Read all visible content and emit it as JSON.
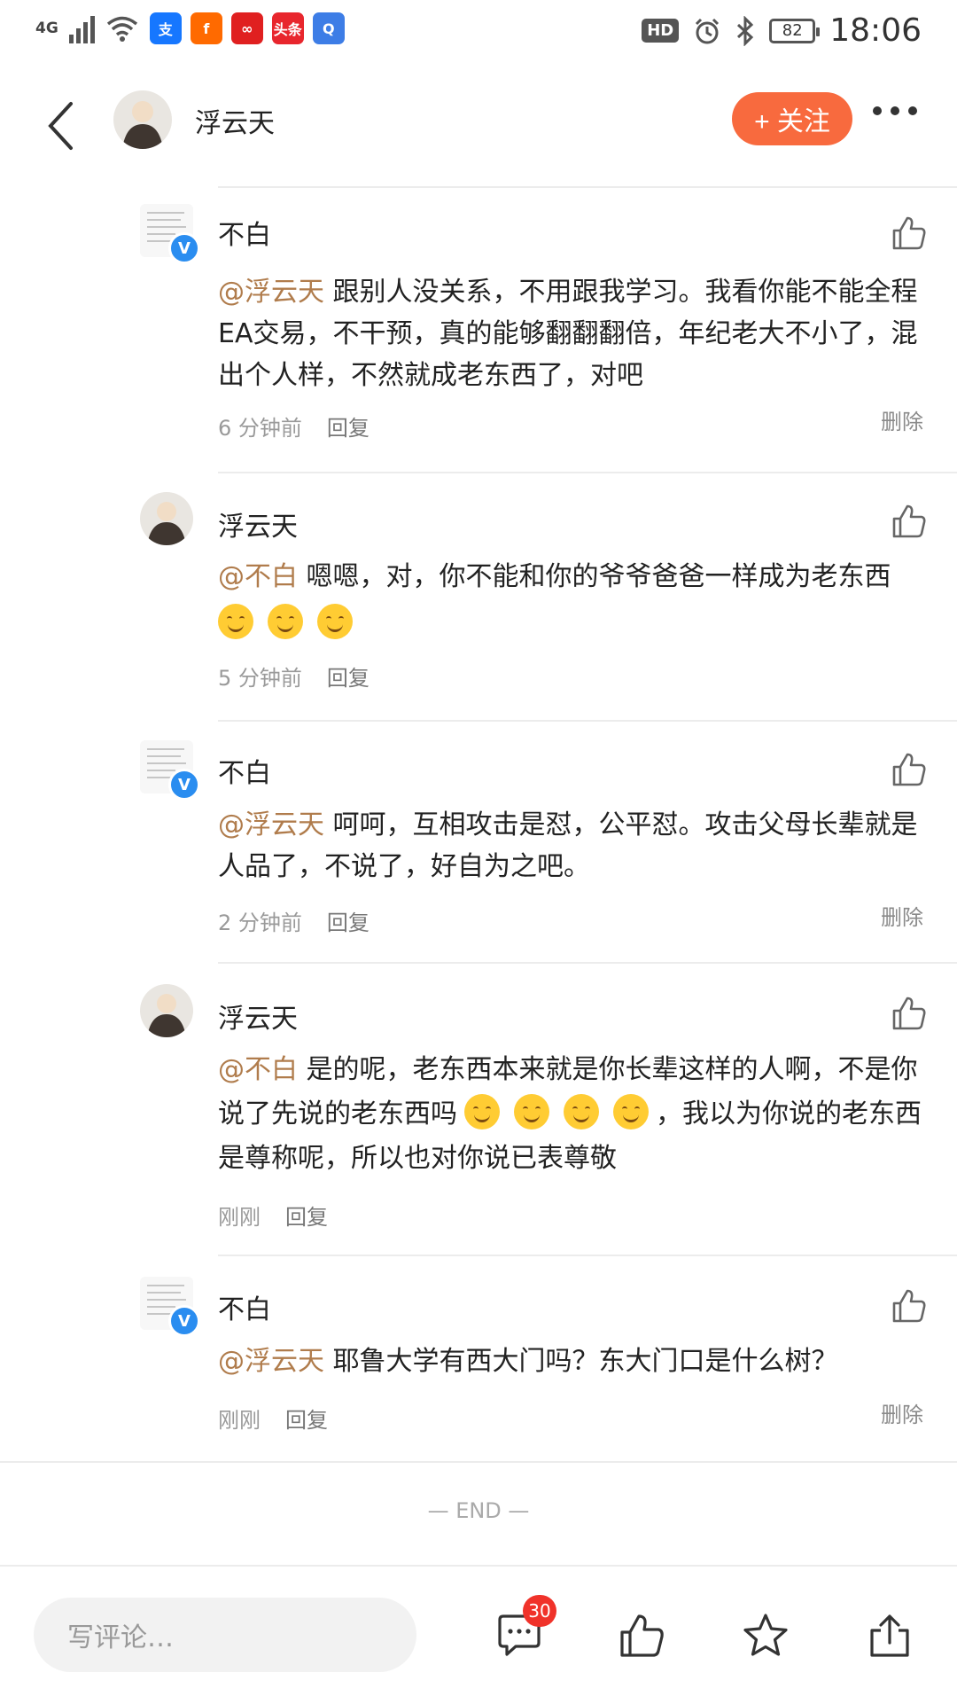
{
  "status_bar": {
    "network": "4G",
    "apps": [
      {
        "icon": "alipay-icon",
        "label": "支",
        "color": "#1677ff"
      },
      {
        "icon": "app-f-icon",
        "label": "f",
        "color": "#ff6a00"
      },
      {
        "icon": "news-red-icon",
        "label": "∞",
        "color": "#e02020"
      },
      {
        "icon": "toutiao-icon",
        "label": "头条",
        "color": "#e8262d"
      },
      {
        "icon": "qq-browser-icon",
        "label": "Q",
        "color": "#3d7de6"
      }
    ],
    "hd": "HD",
    "battery": "82",
    "time": "18:06"
  },
  "header": {
    "name": "浮云天",
    "follow_label": "+ 关注"
  },
  "comments": [
    {
      "user": "不白",
      "verified": true,
      "mention": "@浮云天",
      "text": " 跟别人没关系，不用跟我学习。我看你能不能全程EA交易，不干预，真的能够翻翻翻倍，年纪老大不小了，混出个人样，不然就成老东西了，对吧",
      "time": "6 分钟前",
      "reply": "回复",
      "delete": "删除"
    },
    {
      "user": "浮云天",
      "verified": false,
      "mention": "@不白",
      "text": " 嗯嗯，对，你不能和你的爷爷爸爸一样成为老东西",
      "emoji_count": 3,
      "time": "5 分钟前",
      "reply": "回复"
    },
    {
      "user": "不白",
      "verified": true,
      "mention": "@浮云天",
      "text": " 呵呵，互相攻击是怼，公平怼。攻击父母长辈就是人品了，不说了，好自为之吧。",
      "time": "2 分钟前",
      "reply": "回复",
      "delete": "删除"
    },
    {
      "user": "浮云天",
      "verified": false,
      "mention": "@不白",
      "text_a": " 是的呢，老东西本来就是你长辈这样的人啊，不是你说了先说的老东西吗",
      "emoji_count": 4,
      "text_b": "，我以为你说的老东西是尊称呢，所以也对你说已表尊敬",
      "time": "刚刚",
      "reply": "回复"
    },
    {
      "user": "不白",
      "verified": true,
      "mention": "@浮云天",
      "text": " 耶鲁大学有西大门吗？东大门口是什么树？",
      "time": "刚刚",
      "reply": "回复",
      "delete": "删除"
    }
  ],
  "end_label": "— END —",
  "footer": {
    "input_placeholder": "写评论…",
    "comment_count": "30"
  }
}
